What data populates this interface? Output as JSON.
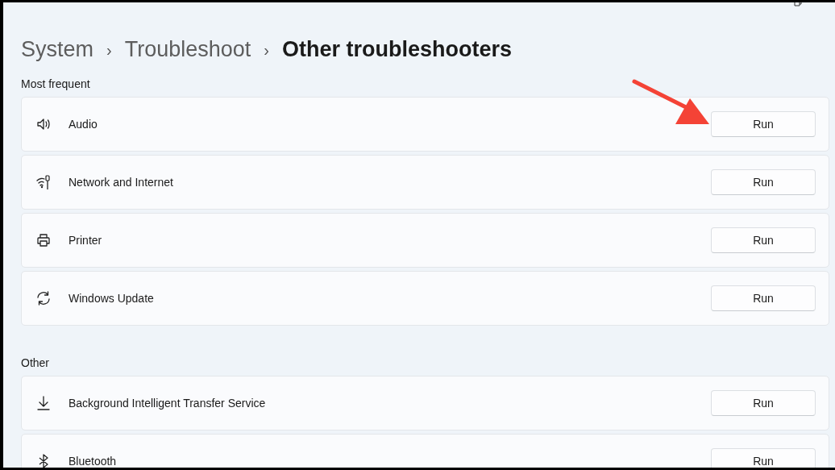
{
  "breadcrumb": [
    {
      "label": "System",
      "current": false
    },
    {
      "label": "Troubleshoot",
      "current": false
    },
    {
      "label": "Other troubleshooters",
      "current": true
    }
  ],
  "separator": "›",
  "sections": [
    {
      "title": "Most frequent",
      "items": [
        {
          "kind": "audio",
          "label": "Audio",
          "button": "Run"
        },
        {
          "kind": "network",
          "label": "Network and Internet",
          "button": "Run"
        },
        {
          "kind": "printer",
          "label": "Printer",
          "button": "Run"
        },
        {
          "kind": "update",
          "label": "Windows Update",
          "button": "Run"
        }
      ]
    },
    {
      "title": "Other",
      "items": [
        {
          "kind": "download",
          "label": "Background Intelligent Transfer Service",
          "button": "Run"
        },
        {
          "kind": "bluetooth",
          "label": "Bluetooth",
          "button": "Run"
        }
      ]
    }
  ]
}
